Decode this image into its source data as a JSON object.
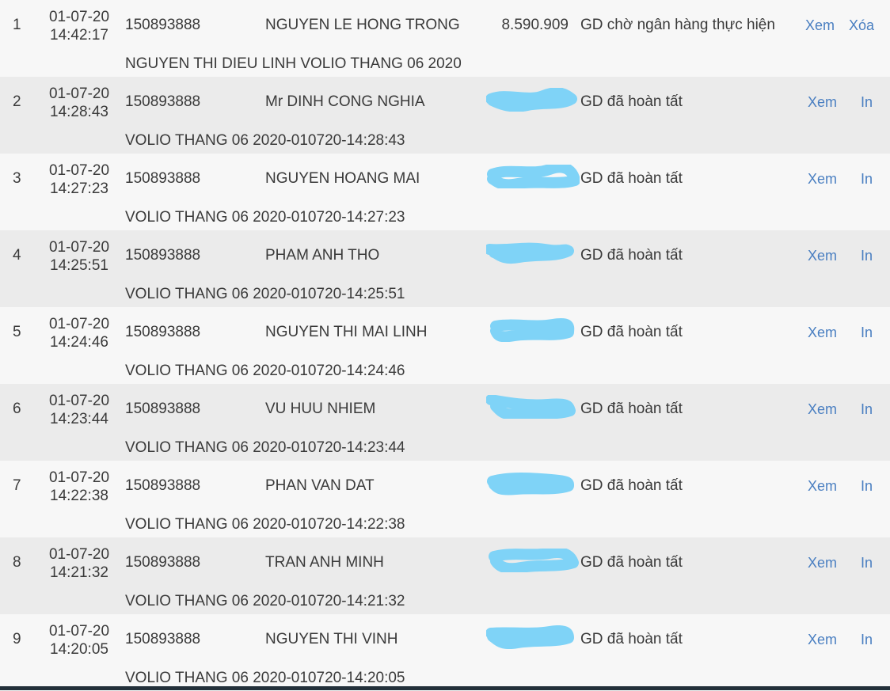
{
  "transactions": [
    {
      "index": "1",
      "date": "01-07-20",
      "time": "14:42:17",
      "account": "150893888",
      "name": "NGUYEN LE HONG TRONG",
      "amount": "8.590.909",
      "status": "GD chờ ngân hàng thực hiện",
      "description": "NGUYEN THI DIEU LINH VOLIO THANG 06 2020",
      "view_label": "Xem",
      "action_label": "Xóa"
    },
    {
      "index": "2",
      "date": "01-07-20",
      "time": "14:28:43",
      "account": "150893888",
      "name": "Mr DINH CONG NGHIA",
      "amount": "",
      "status": "GD đã hoàn tất",
      "description": "VOLIO THANG 06 2020-010720-14:28:43",
      "view_label": "Xem",
      "action_label": "In"
    },
    {
      "index": "3",
      "date": "01-07-20",
      "time": "14:27:23",
      "account": "150893888",
      "name": "NGUYEN HOANG MAI",
      "amount": "",
      "status": "GD đã hoàn tất",
      "description": "VOLIO THANG 06 2020-010720-14:27:23",
      "view_label": "Xem",
      "action_label": "In"
    },
    {
      "index": "4",
      "date": "01-07-20",
      "time": "14:25:51",
      "account": "150893888",
      "name": "PHAM ANH THO",
      "amount": "",
      "status": "GD đã hoàn tất",
      "description": "VOLIO THANG 06 2020-010720-14:25:51",
      "view_label": "Xem",
      "action_label": "In"
    },
    {
      "index": "5",
      "date": "01-07-20",
      "time": "14:24:46",
      "account": "150893888",
      "name": "NGUYEN THI MAI LINH",
      "amount": "",
      "status": "GD đã hoàn tất",
      "description": "VOLIO THANG 06 2020-010720-14:24:46",
      "view_label": "Xem",
      "action_label": "In"
    },
    {
      "index": "6",
      "date": "01-07-20",
      "time": "14:23:44",
      "account": "150893888",
      "name": "VU HUU NHIEM",
      "amount": "",
      "status": "GD đã hoàn tất",
      "description": "VOLIO THANG 06 2020-010720-14:23:44",
      "view_label": "Xem",
      "action_label": "In"
    },
    {
      "index": "7",
      "date": "01-07-20",
      "time": "14:22:38",
      "account": "150893888",
      "name": "PHAN VAN DAT",
      "amount": "",
      "status": "GD đã hoàn tất",
      "description": "VOLIO THANG 06 2020-010720-14:22:38",
      "view_label": "Xem",
      "action_label": "In"
    },
    {
      "index": "8",
      "date": "01-07-20",
      "time": "14:21:32",
      "account": "150893888",
      "name": "TRAN ANH MINH",
      "amount": "",
      "status": "GD đã hoàn tất",
      "description": "VOLIO THANG 06 2020-010720-14:21:32",
      "view_label": "Xem",
      "action_label": "In"
    },
    {
      "index": "9",
      "date": "01-07-20",
      "time": "14:20:05",
      "account": "150893888",
      "name": "NGUYEN THI VINH",
      "amount": "",
      "status": "GD đã hoàn tất",
      "description": "VOLIO THANG 06 2020-010720-14:20:05",
      "view_label": "Xem",
      "action_label": "In"
    }
  ],
  "colors": {
    "row_light": "#f7f7f7",
    "row_alt": "#ebebeb",
    "link": "#4a7fc1",
    "redaction": "#7fd3f7",
    "text": "#3a3a3a"
  }
}
